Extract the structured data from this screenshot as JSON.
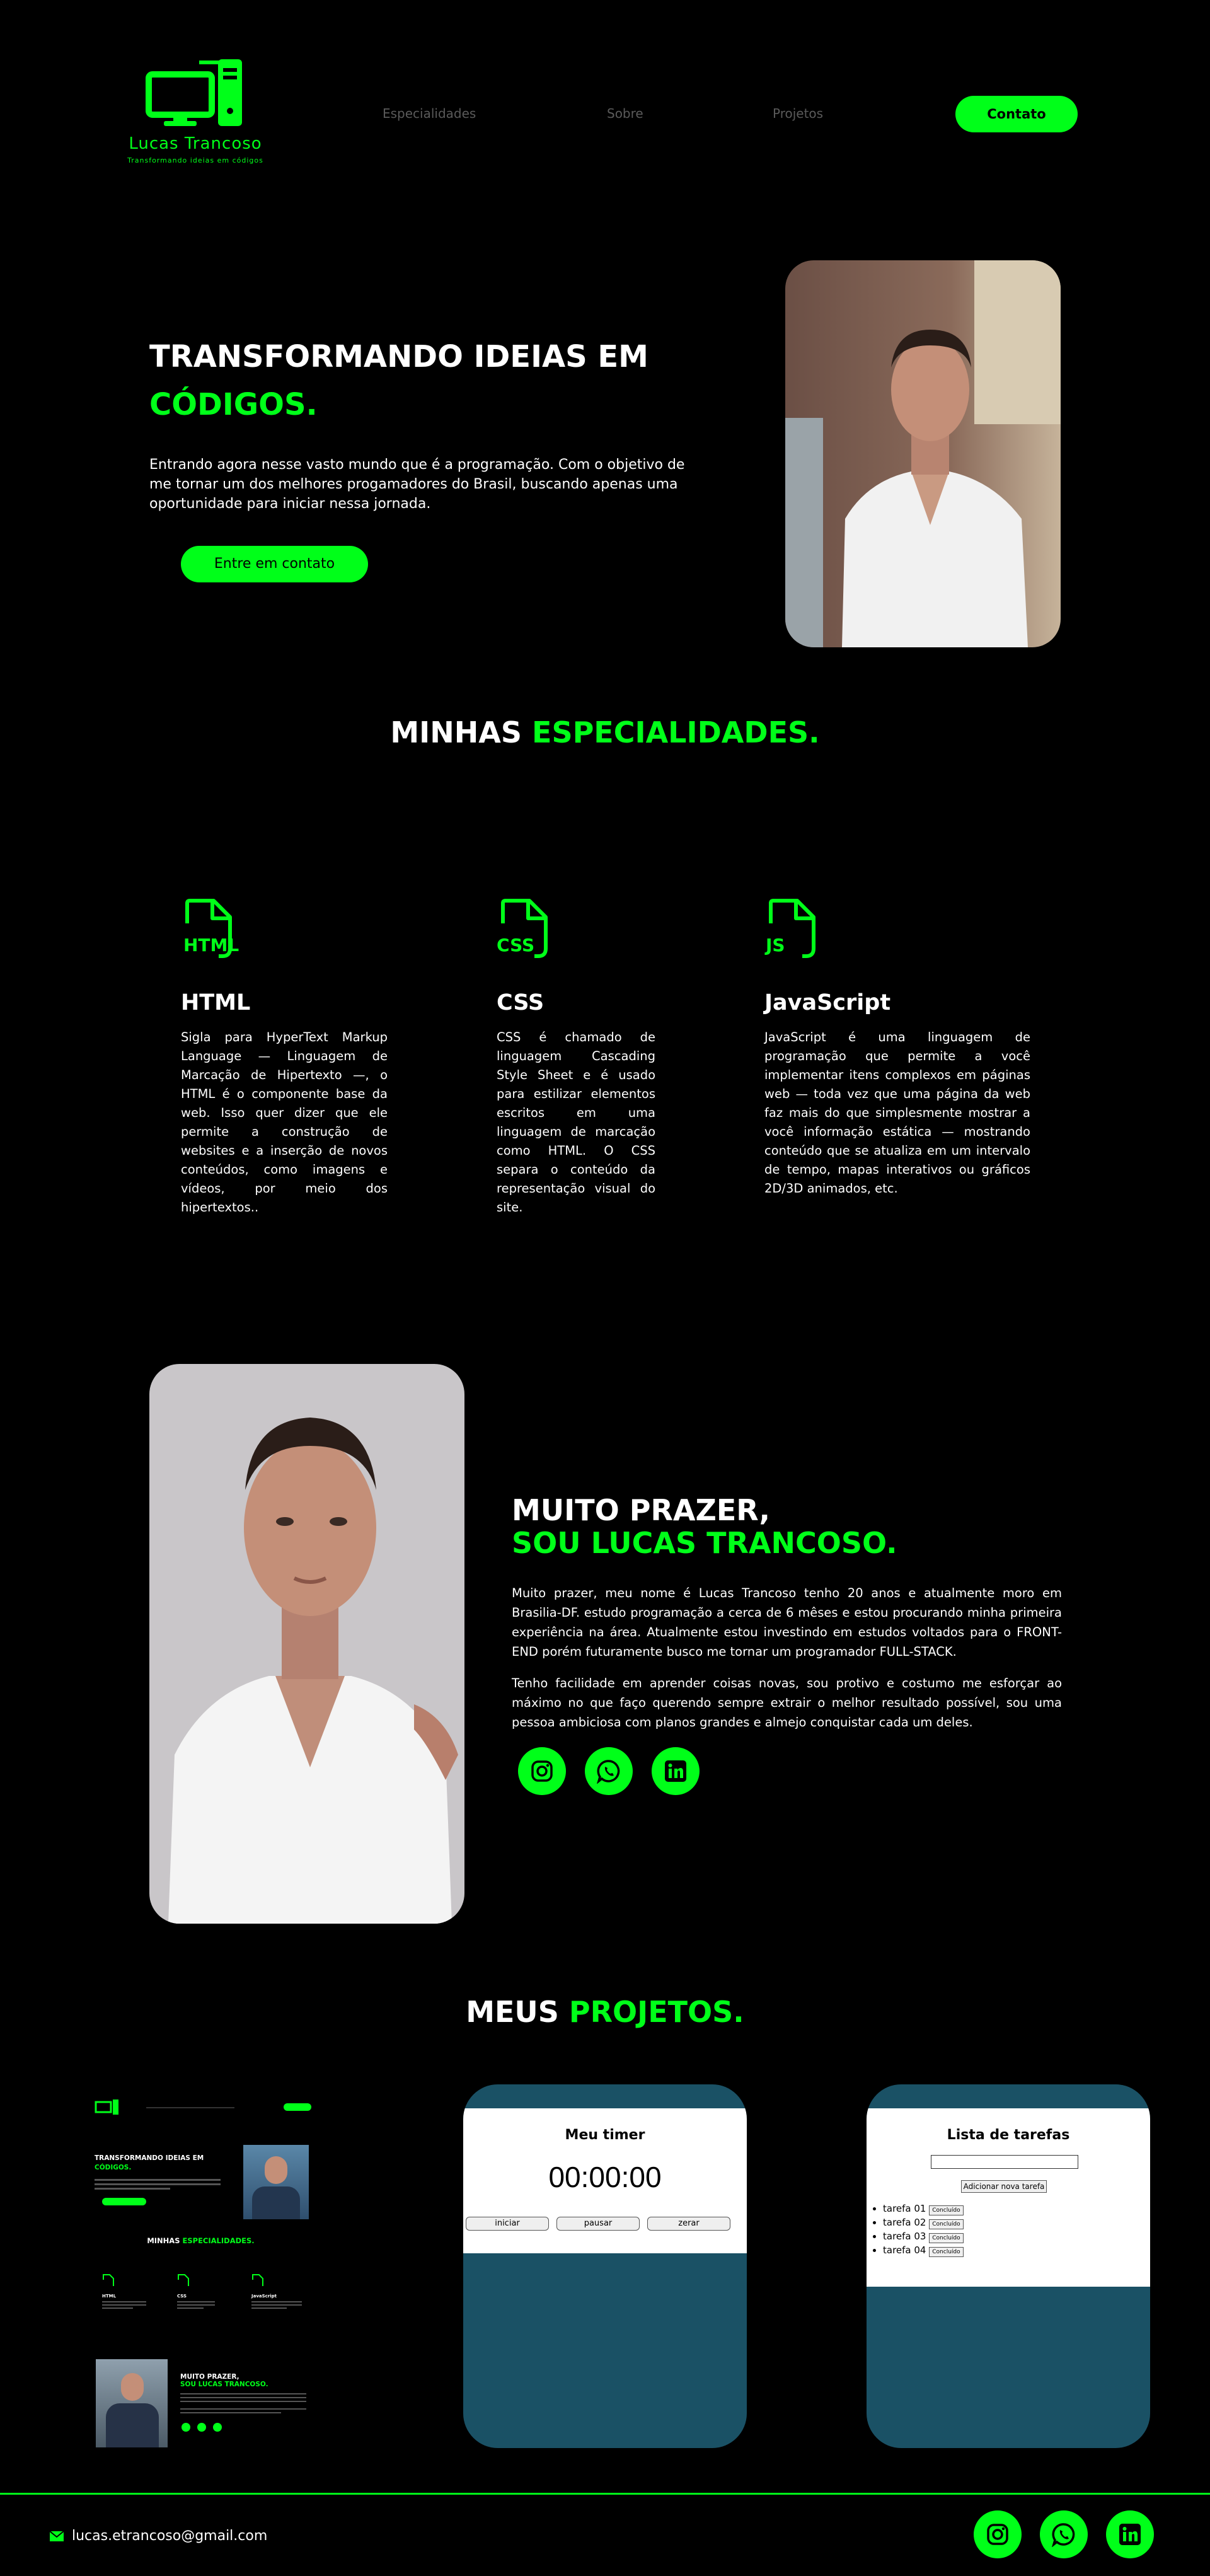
{
  "header": {
    "logo_name": "Lucas Trancoso",
    "logo_tagline": "Transformando ideias em códigos",
    "nav": [
      "Especialidades",
      "Sobre",
      "Projetos"
    ],
    "contact_label": "Contato"
  },
  "hero": {
    "title_line1": "TRANSFORMANDO IDEIAS EM",
    "title_line2": "CÓDIGOS.",
    "text": "Entrando agora nesse vasto mundo que é a programação. Com o objetivo de me tornar um dos melhores progamadores do Brasil, buscando apenas uma oportunidade para iniciar nessa jornada.",
    "button_label": "Entre em contato"
  },
  "specialties": {
    "title_white": "MINHAS",
    "title_green": "ESPECIALIDADES.",
    "items": [
      {
        "icon_label": "HTML",
        "name": "HTML",
        "text": "Sigla para HyperText Markup Language — Linguagem de Marcação de Hipertexto —, o HTML é o componente base da web. Isso quer dizer que ele permite a construção de websites e a inserção de novos conteúdos, como imagens e vídeos, por meio dos hipertextos.."
      },
      {
        "icon_label": "CSS",
        "name": "CSS",
        "text": "CSS é chamado de linguagem Cascading Style Sheet e é usado para estilizar elementos escritos em uma linguagem de marcação como HTML. O CSS separa o conteúdo da representação visual do site."
      },
      {
        "icon_label": "JS",
        "name": "JavaScript",
        "text": "JavaScript é uma linguagem de programação que permite a você implementar itens complexos em páginas web — toda vez que uma página da web faz mais do que simplesmente mostrar a você informação estática — mostrando conteúdo que se atualiza em um intervalo de tempo, mapas interativos ou gráficos 2D/3D animados, etc."
      }
    ]
  },
  "about": {
    "title_line1": "MUITO PRAZER,",
    "title_line2": "SOU LUCAS TRANCOSO.",
    "p1": "Muito prazer, meu nome é Lucas Trancoso tenho 20 anos e atualmente moro em Brasilia-DF. estudo programação a cerca de 6 mêses e estou procurando minha primeira experiência na área. Atualmente estou investindo em estudos voltados para o FRONT-END porém futuramente busco me tornar um programador FULL-STACK.",
    "p2": "Tenho facilidade em aprender coisas novas, sou protivo e costumo me esforçar ao máximo no que faço querendo sempre extrair o melhor resultado possível, sou uma pessoa ambiciosa com planos grandes e almejo conquistar cada um deles."
  },
  "projects": {
    "title_white": "MEUS",
    "title_green": "PROJETOS.",
    "preview": {
      "title_line1": "TRANSFORMANDO IDEIAS EM",
      "title_line2": "CÓDIGOS.",
      "spec_title_white": "MINHAS",
      "spec_title_green": "ESPECIALIDADES.",
      "spec_names": [
        "HTML",
        "CSS",
        "JavaScript"
      ],
      "about_line1": "MUITO PRAZER,",
      "about_line2": "SOU LUCAS TRANCOSO."
    },
    "timer": {
      "title": "Meu timer",
      "time": "00:00:00",
      "buttons": [
        "iniciar",
        "pausar",
        "zerar"
      ]
    },
    "todo": {
      "title": "Lista de tarefas",
      "input_value": "",
      "add_label": "Adicionar nova tarefa",
      "tasks": [
        "tarefa 01",
        "tarefa 02",
        "tarefa 03",
        "tarefa 04"
      ],
      "done_label": "Concluído"
    }
  },
  "footer": {
    "email": "lucas.etrancoso@gmail.com"
  },
  "colors": {
    "accent": "#00ff19",
    "background": "#000000",
    "phone": "#1a5165"
  },
  "icons": [
    "monitor-icon",
    "file-code-icon",
    "instagram-icon",
    "whatsapp-icon",
    "linkedin-icon",
    "mail-icon"
  ]
}
